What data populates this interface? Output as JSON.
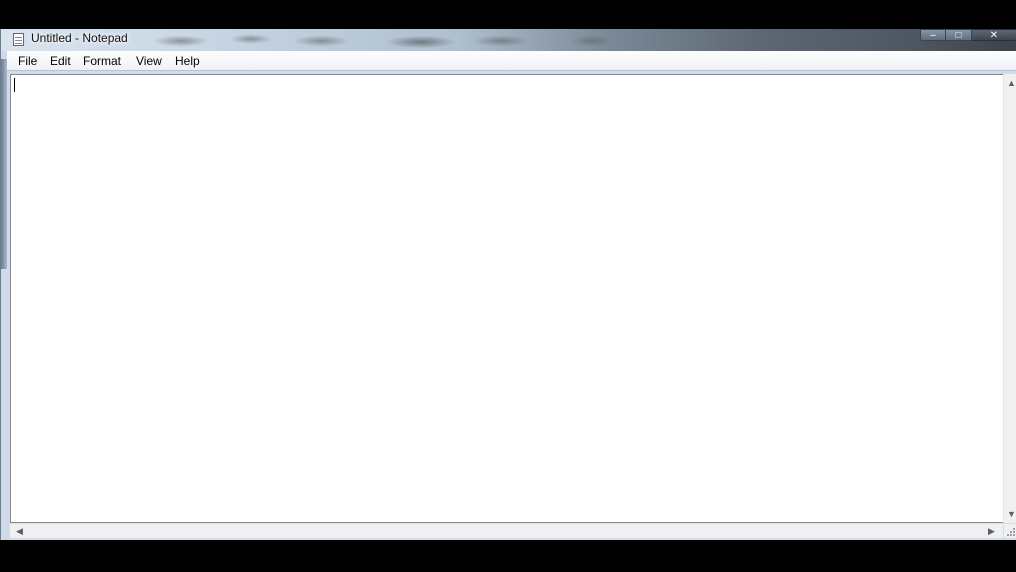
{
  "window": {
    "title": "Untitled - Notepad",
    "controls": {
      "minimize": "–",
      "maximize": "□",
      "close": "✕"
    }
  },
  "menu": {
    "items": [
      {
        "id": "file",
        "label": "File"
      },
      {
        "id": "edit",
        "label": "Edit"
      },
      {
        "id": "format",
        "label": "Format"
      },
      {
        "id": "view",
        "label": "View"
      },
      {
        "id": "help",
        "label": "Help"
      }
    ]
  },
  "editor": {
    "content": ""
  },
  "scrollbars": {
    "up_arrow": "▲",
    "down_arrow": "▼",
    "left_arrow": "◀",
    "right_arrow": "▶"
  },
  "icons": {
    "app": "notepad-icon"
  }
}
